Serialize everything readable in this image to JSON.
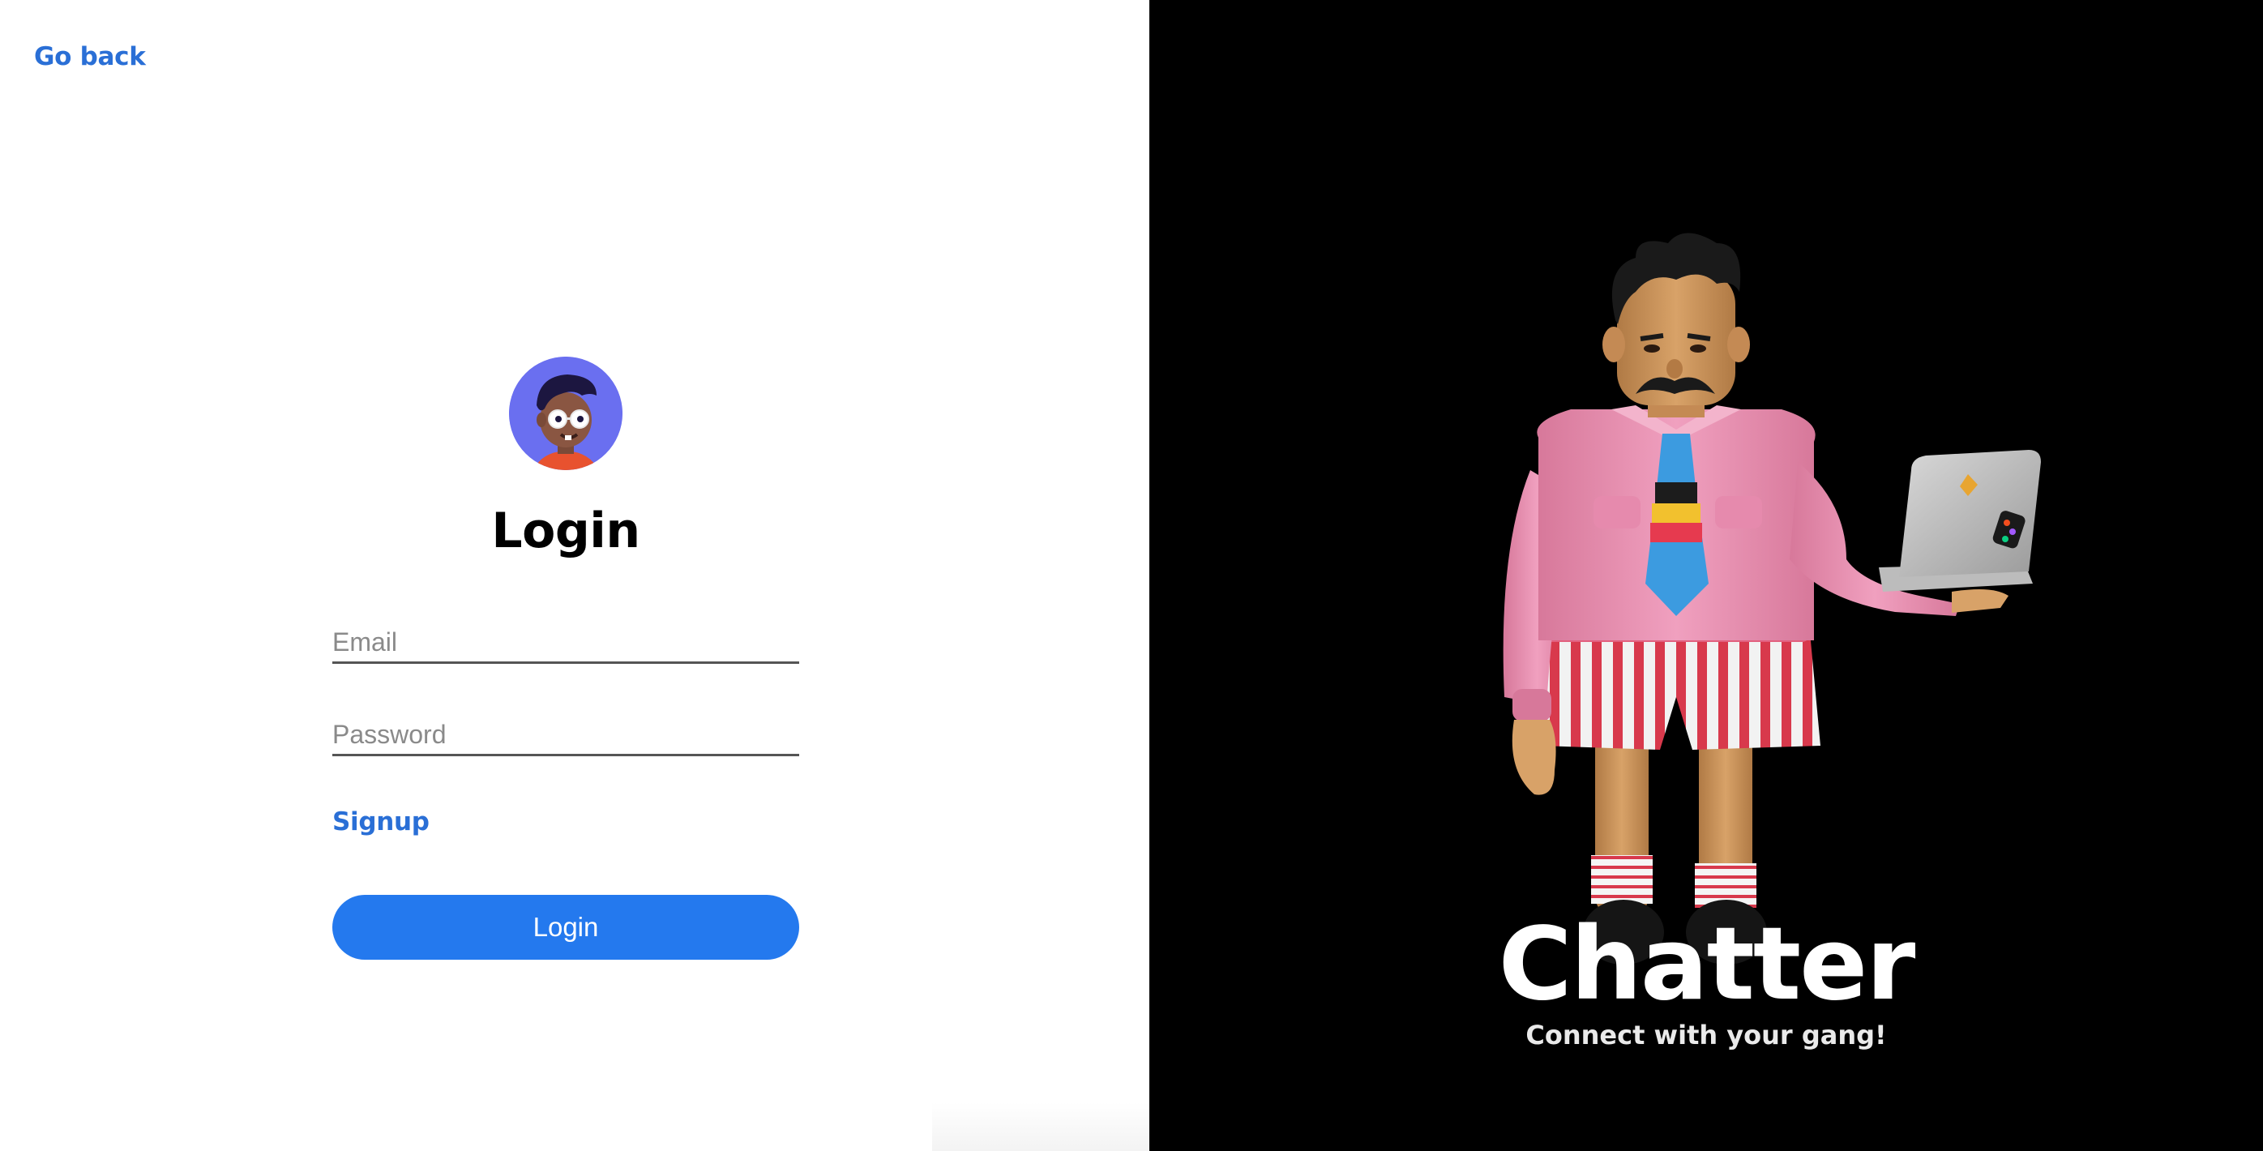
{
  "nav": {
    "go_back_label": "Go back"
  },
  "login": {
    "title": "Login",
    "email_placeholder": "Email",
    "email_value": "",
    "password_placeholder": "Password",
    "password_value": "",
    "signup_label": "Signup",
    "submit_label": "Login"
  },
  "brand": {
    "name": "Chatter",
    "tagline": "Connect with your gang!"
  },
  "colors": {
    "accent": "#2479ee",
    "link": "#2a6fd6",
    "avatar_bg": "#6a6ff0",
    "right_panel_bg": "#000000"
  },
  "icons": {
    "avatar": "user-avatar-icon",
    "illustration": "character-with-laptop-illustration"
  }
}
